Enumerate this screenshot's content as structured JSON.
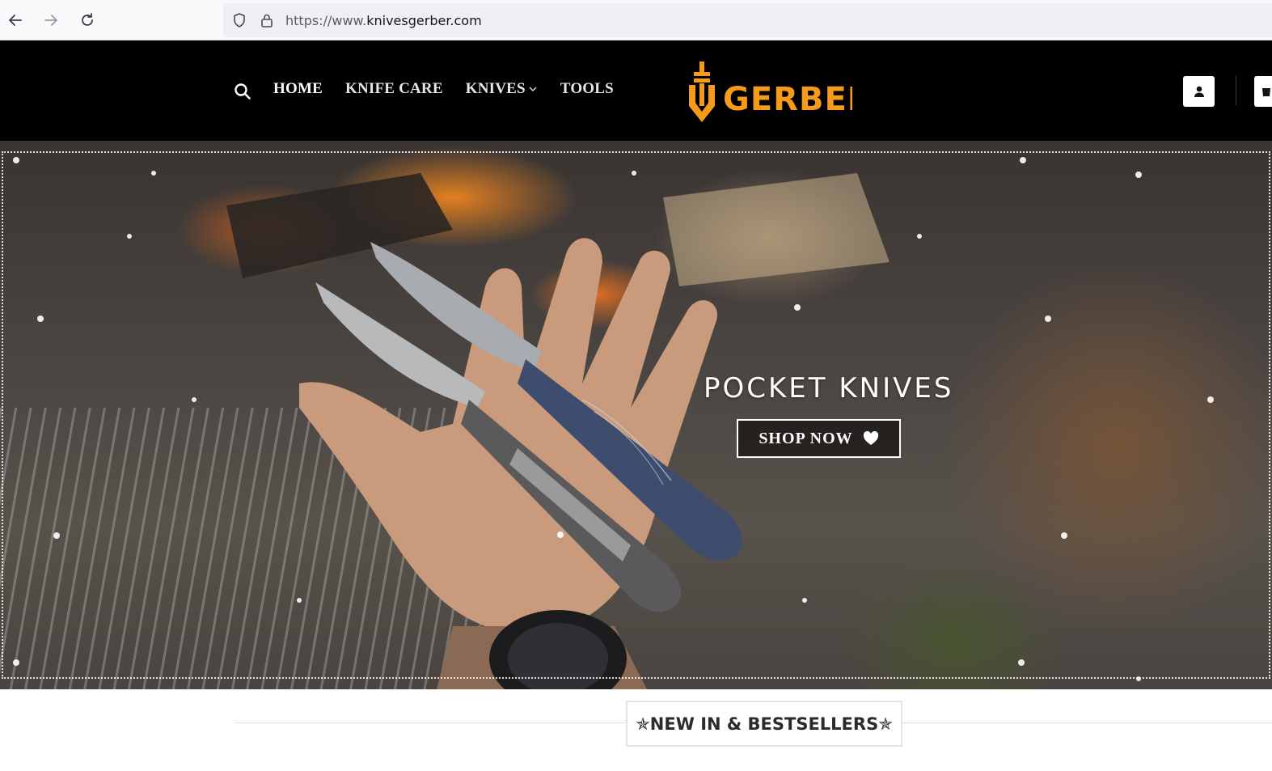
{
  "browser": {
    "url_scheme": "https://www.",
    "url_host": "knivesgerber.com",
    "back_icon": "arrow-left-icon",
    "forward_icon": "arrow-right-icon",
    "reload_icon": "reload-icon"
  },
  "header": {
    "nav": [
      {
        "label": "HOME",
        "active": true
      },
      {
        "label": "KNIFE CARE",
        "active": false
      },
      {
        "label": "KNIVES",
        "active": false,
        "has_dropdown": true
      },
      {
        "label": "TOOLS",
        "active": false
      }
    ],
    "logo_text": "GERBER",
    "icons": [
      "search-icon",
      "user-icon",
      "cart-icon"
    ]
  },
  "hero": {
    "title": "POCKET KNIVES",
    "cta_label": "SHOP NOW",
    "cta_icon": "heart-icon"
  },
  "section": {
    "title": "✯NEW IN & BESTSELLERS✯"
  },
  "colors": {
    "header_bg": "#000000",
    "logo_orange": "#f59a1b",
    "hero_text": "#ffffff"
  }
}
